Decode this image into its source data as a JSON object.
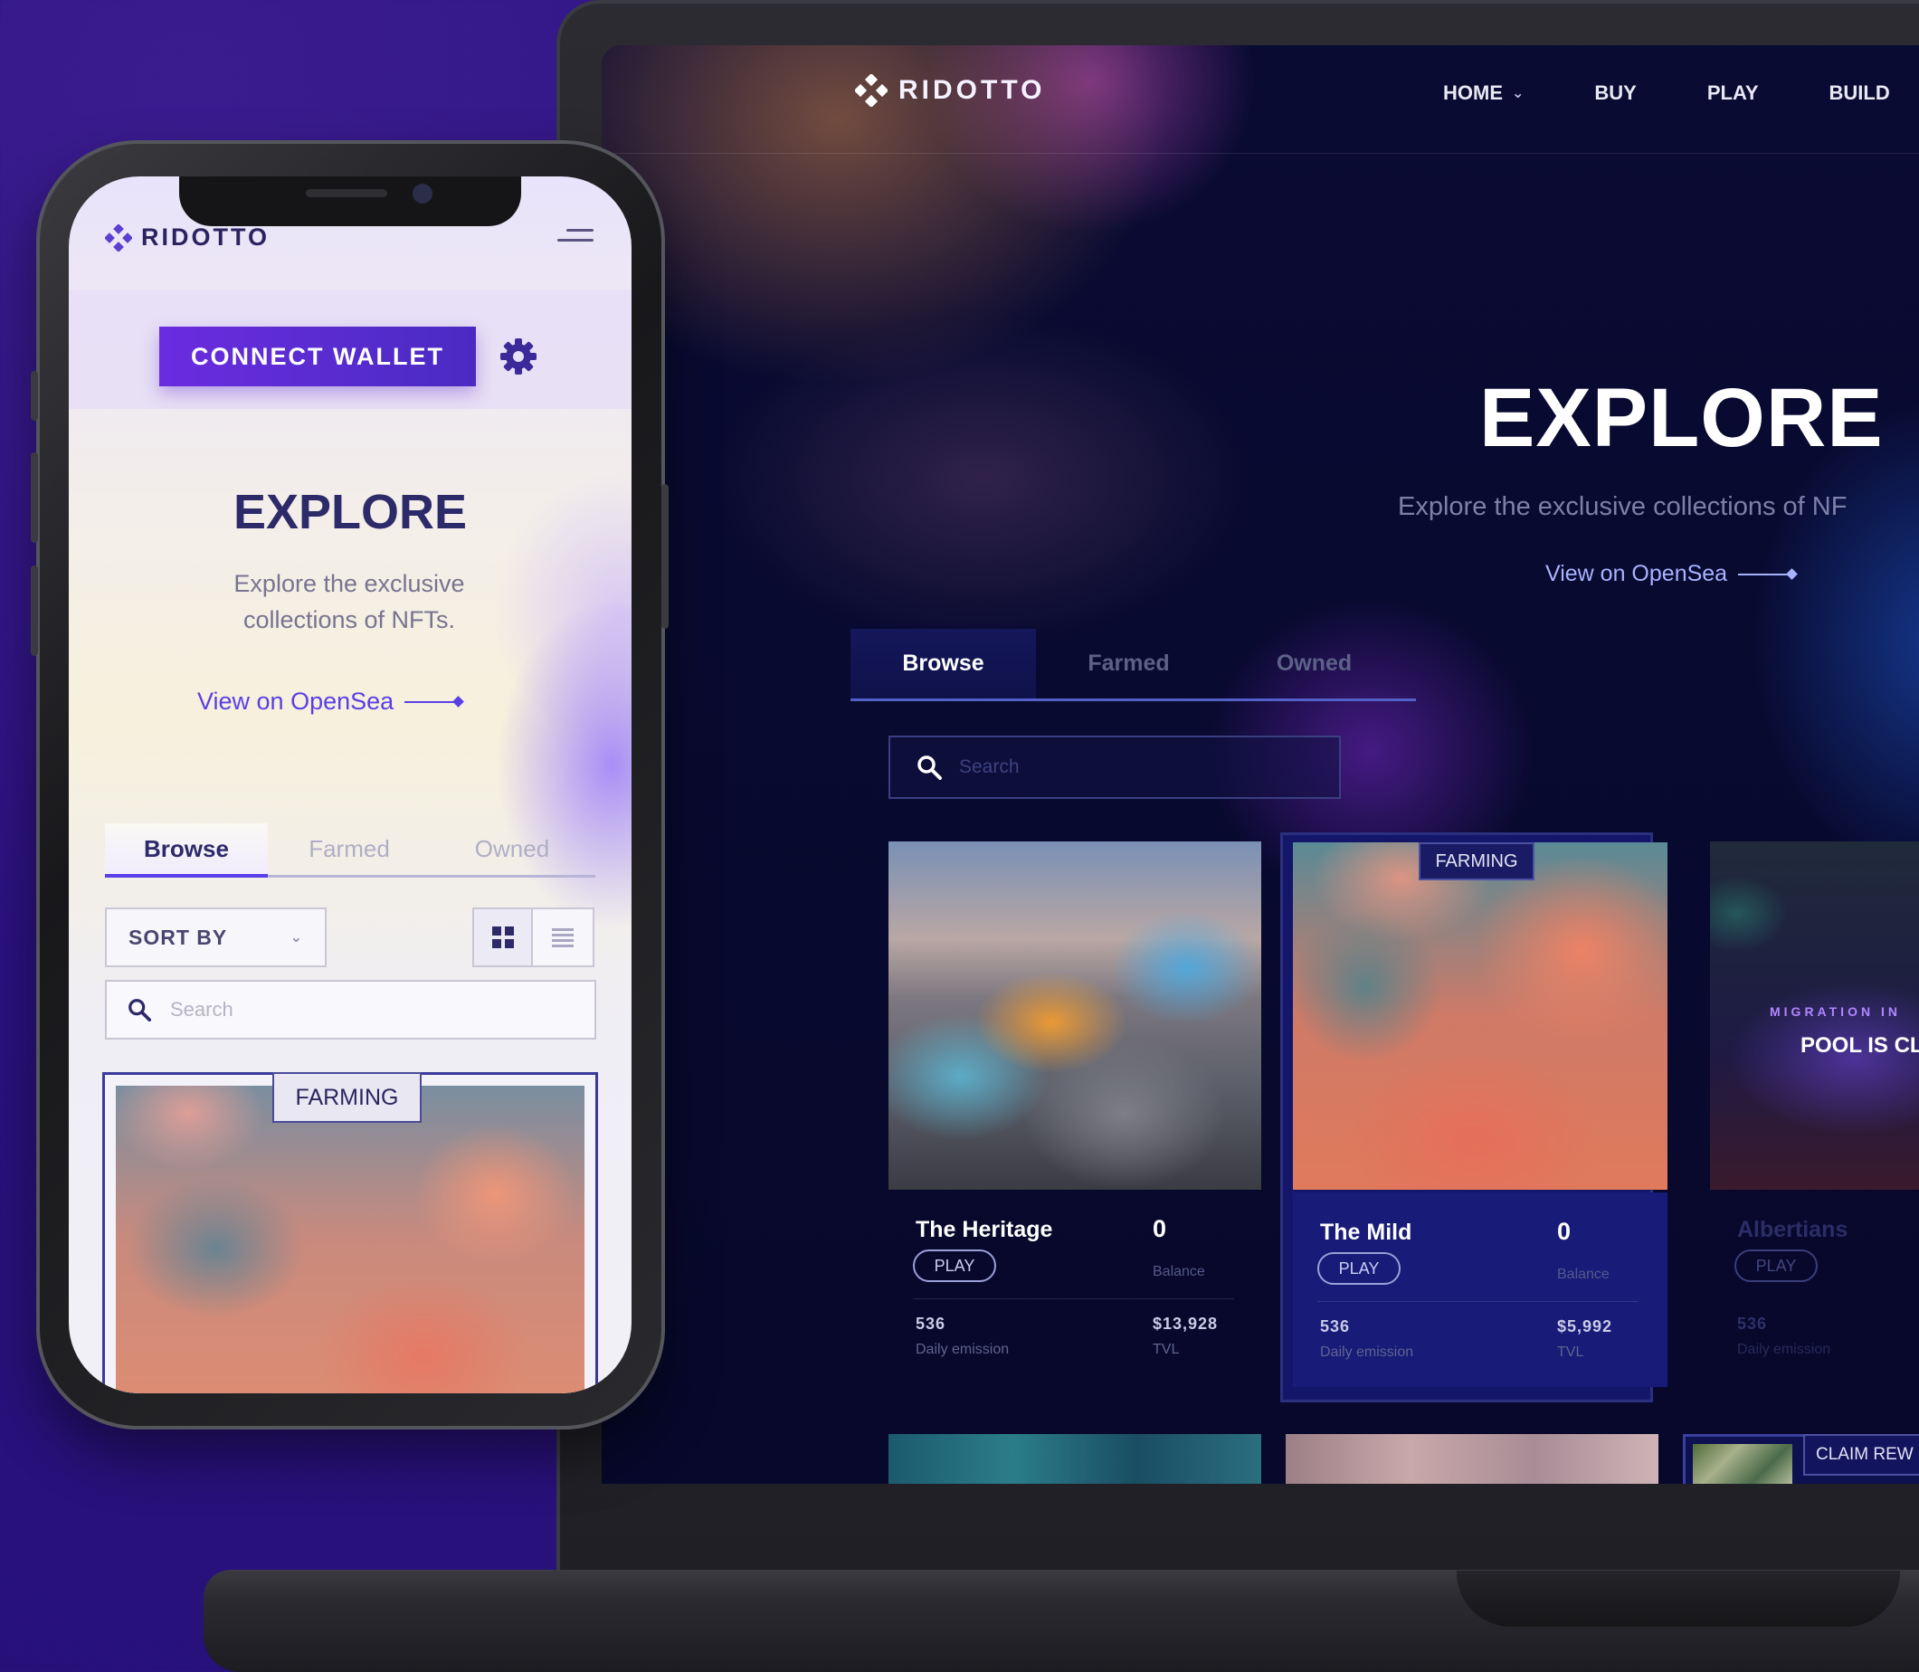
{
  "brand": {
    "name": "RIDOTTO"
  },
  "colors": {
    "accent": "#5a3fe6",
    "background": "#2a1280",
    "dark_screen": "#070a2e"
  },
  "desktop": {
    "nav": [
      {
        "label": "HOME",
        "has_dropdown": true
      },
      {
        "label": "BUY"
      },
      {
        "label": "PLAY"
      },
      {
        "label": "BUILD"
      }
    ],
    "hero": {
      "title": "EXPLORE",
      "subtitle": "Explore the exclusive collections of NF",
      "link": "View on OpenSea"
    },
    "tabs": [
      "Browse",
      "Farmed",
      "Owned"
    ],
    "active_tab": "Browse",
    "search": {
      "placeholder": "Search"
    },
    "cards": [
      {
        "title": "The Heritage",
        "balance": "0",
        "balance_label": "Balance",
        "play": "PLAY",
        "daily_emission": "536",
        "daily_emission_label": "Daily emission",
        "tvl": "$13,928",
        "tvl_label": "TVL"
      },
      {
        "title": "The Mild",
        "tag": "FARMING",
        "balance": "0",
        "balance_label": "Balance",
        "play": "PLAY",
        "daily_emission": "536",
        "daily_emission_label": "Daily emission",
        "tvl": "$5,992",
        "tvl_label": "TVL"
      },
      {
        "title": "Albertians",
        "migration": "MIGRATION IN",
        "pool_text": "POOL IS CL",
        "play": "PLAY",
        "daily_emission": "536",
        "daily_emission_label": "Daily emission"
      }
    ],
    "claim_tag": "CLAIM REW"
  },
  "mobile": {
    "connect_wallet": "CONNECT WALLET",
    "title": "EXPLORE",
    "subtitle_line1": "Explore the exclusive",
    "subtitle_line2": "collections of NFTs.",
    "link": "View on OpenSea",
    "tabs": [
      "Browse",
      "Farmed",
      "Owned"
    ],
    "active_tab": "Browse",
    "sort_by": "SORT BY",
    "search": {
      "placeholder": "Search"
    },
    "card_tag": "FARMING"
  }
}
